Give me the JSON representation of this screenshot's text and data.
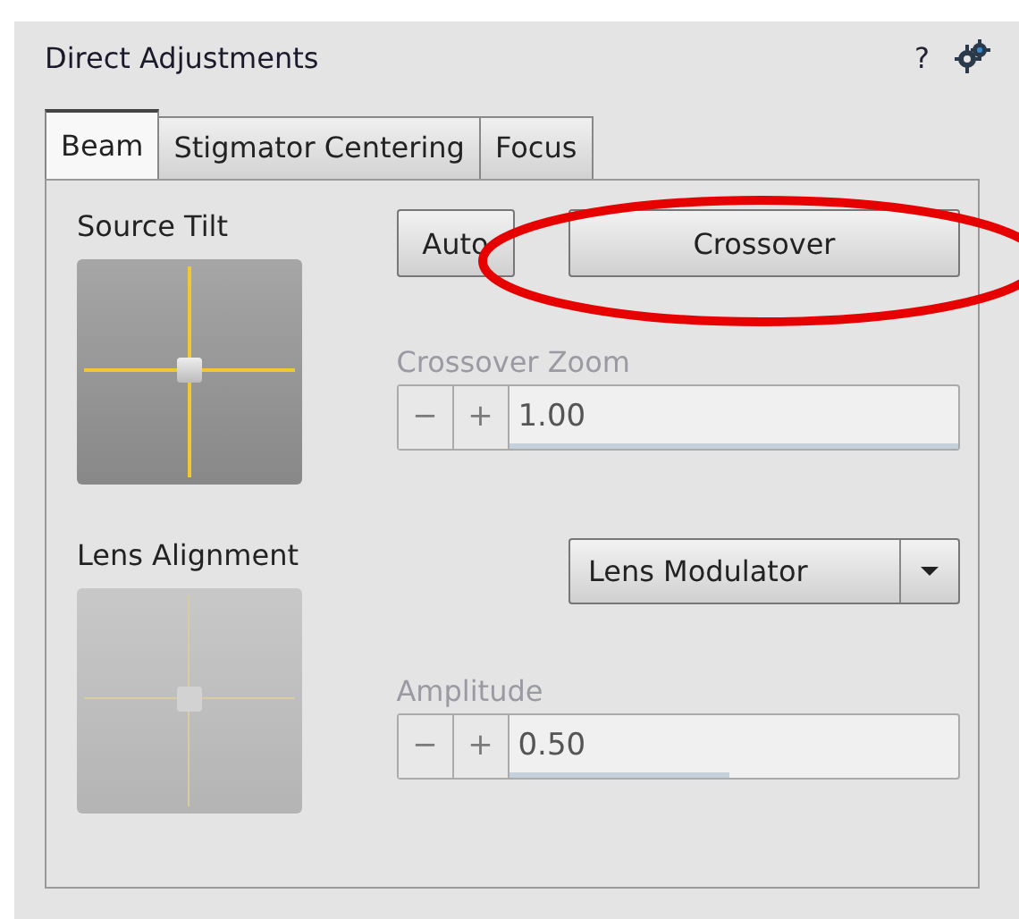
{
  "panel": {
    "title": "Direct Adjustments",
    "help": "?"
  },
  "tabs": [
    {
      "label": "Beam",
      "selected": true
    },
    {
      "label": "Stigmator Centering",
      "selected": false
    },
    {
      "label": "Focus",
      "selected": false
    }
  ],
  "sections": [
    {
      "label": "Source Tilt",
      "pad_disabled": false,
      "control": {
        "kind": "buttons",
        "buttons": [
          "Auto",
          "Crossover"
        ]
      },
      "field": {
        "label": "Crossover Zoom",
        "minus": "−",
        "plus": "+",
        "value": "1.00",
        "level": 1.0,
        "disabled": true
      }
    },
    {
      "label": "Lens Alignment",
      "pad_disabled": true,
      "control": {
        "kind": "dropdown",
        "value": "Lens Modulator"
      },
      "field": {
        "label": "Amplitude",
        "minus": "−",
        "plus": "+",
        "value": "0.50",
        "level": 0.49,
        "disabled": true
      }
    }
  ],
  "annotations": [
    {
      "kind": "ellipse",
      "color": "#e60000"
    }
  ]
}
